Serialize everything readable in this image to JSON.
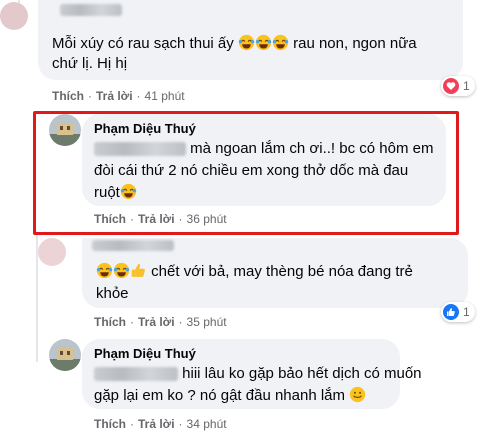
{
  "comments": [
    {
      "text": "Mỗi xúy có rau sạch thui ấy",
      "text_after_emoji": "rau non, ngon nữa",
      "text_line2": "chứ lị. Hị hị",
      "actions": {
        "like": "Thích",
        "reply": "Trả lời",
        "time": "41 phút"
      },
      "reaction": {
        "type": "love",
        "count": "1",
        "color": "#f33e58"
      }
    },
    {
      "name": "Phạm Diệu Thuý",
      "line1": "mà ngoan lắm ch ơi..! bc có hôm em",
      "line2": "đòi cái thứ 2 nó chiều em xong thở dốc mà đau",
      "line3": "ruột",
      "actions": {
        "like": "Thích",
        "reply": "Trả lời",
        "time": "36 phút"
      }
    },
    {
      "line1": "chết với bả, may thèng bé nóa đang trẻ",
      "line2": "khỏe",
      "actions": {
        "like": "Thích",
        "reply": "Trả lời",
        "time": "35 phút"
      },
      "reaction": {
        "type": "like",
        "count": "1",
        "color": "#1877f2"
      }
    },
    {
      "name": "Phạm Diệu Thuý",
      "line1": "hiii lâu ko gặp bảo hết dịch có muốn",
      "line2": "gặp lại em ko ? nó gật đầu nhanh lắm",
      "actions": {
        "like": "Thích",
        "reply": "Trả lời",
        "time": "34 phút"
      }
    }
  ],
  "colors": {
    "highlight": "#e0191b",
    "bubble": "#f0f2f5",
    "meta": "#65676b"
  },
  "icons": [
    "laughing-emoji",
    "thumbs-up-emoji",
    "smile-emoji",
    "heart-reaction-icon",
    "like-reaction-icon"
  ]
}
